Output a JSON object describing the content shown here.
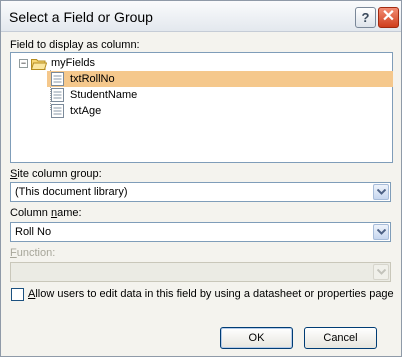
{
  "window": {
    "title": "Select a Field or Group"
  },
  "field_label": "Field to display as column:",
  "tree": {
    "root": "myFields",
    "expander": "−",
    "items": [
      {
        "label": "txtRollNo",
        "selected": true
      },
      {
        "label": "StudentName",
        "selected": false
      },
      {
        "label": "txtAge",
        "selected": false
      }
    ]
  },
  "site_group": {
    "label_access": "S",
    "label_rest": "ite column group:",
    "value": "(This document library)"
  },
  "column_name": {
    "label_pre": "Column ",
    "label_access": "n",
    "label_post": "ame:",
    "value": "Roll No"
  },
  "function": {
    "label_access": "F",
    "label_rest": "unction:",
    "value": ""
  },
  "allow_edit": {
    "checked": false,
    "label_access": "A",
    "label_rest": "llow users to edit data in this field by using a datasheet or properties page"
  },
  "buttons": {
    "ok": "OK",
    "cancel": "Cancel"
  },
  "colors": {
    "selection": "#f5c88c",
    "frame": "#f4f3ee",
    "close": "#cf3e1c"
  },
  "icons": {
    "help": "?",
    "close": "✕"
  }
}
